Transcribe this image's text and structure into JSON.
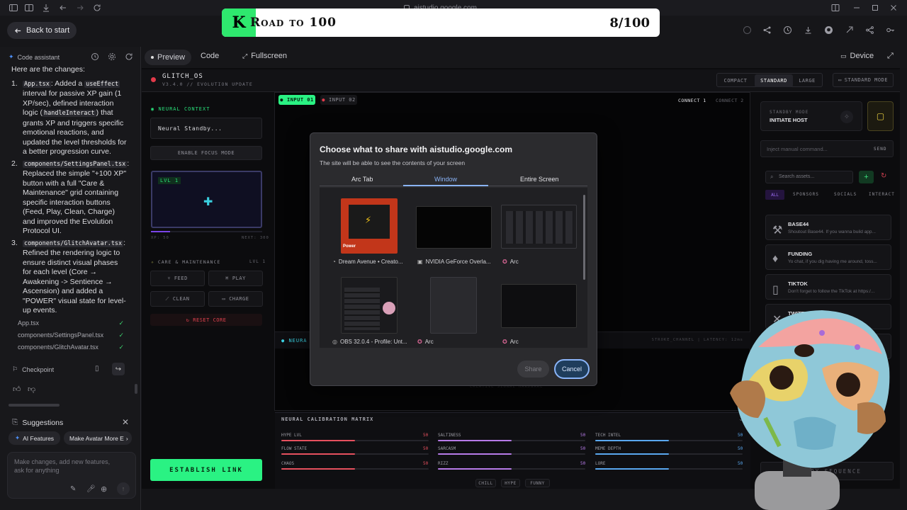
{
  "browser": {
    "url": "aistudio.google.com"
  },
  "overlay": {
    "logo_letter": "K",
    "title": "Road to 100",
    "counter": "8/100"
  },
  "header": {
    "back_label": "Back to start"
  },
  "left_panel": {
    "title": "Code assistant",
    "intro": "Here are the changes:",
    "changes": [
      {
        "num": "1.",
        "file": "App.tsx",
        "text_a": ": Added a ",
        "code": "useEffect",
        "text_b": " interval for passive XP gain (1 XP/sec), defined interaction logic (",
        "code2": "handleInteract",
        "text_c": ") that grants XP and triggers specific emotional reactions, and updated the level thresholds for a better progression curve."
      },
      {
        "num": "2.",
        "file": "components/SettingsPanel.tsx",
        "text_a": ": Replaced the simple \"+100 XP\" button with a full \"Care & Maintenance\" grid containing specific interaction buttons (Feed, Play, Clean, Charge) and improved the Evolution Protocol UI."
      },
      {
        "num": "3.",
        "file": "components/GlitchAvatar.tsx",
        "text_a": ": Refined the rendering logic to ensure distinct visual phases for each level (Core → Awakening -> Sentience → Ascension) and added a \"POWER\" visual state for level-up events."
      }
    ],
    "files": [
      "App.tsx",
      "components/SettingsPanel.tsx",
      "components/GlitchAvatar.tsx"
    ],
    "checkpoint": "Checkpoint",
    "suggestions_title": "Suggestions",
    "suggestion_chips": [
      "AI Features",
      "Make Avatar More E"
    ],
    "input_placeholder": "Make changes, add new features, ask for anything"
  },
  "tabs": {
    "preview": "Preview",
    "code": "Code",
    "fullscreen": "Fullscreen",
    "device": "Device"
  },
  "app": {
    "name": "GLITCH_OS",
    "version": "V3.4.0 // EVOLUTION UPDATE",
    "view_modes": [
      "COMPACT",
      "STANDARD",
      "LARGE"
    ],
    "mode_button": "STANDARD MODE",
    "neural_context": "NEURAL CONTEXT",
    "standby_text": "Neural Standby...",
    "focus_mode": "ENABLE FOCUS MODE",
    "level": "LVL 1",
    "xp": "XP: 50",
    "next": "NEXT: 300",
    "xp_progress": 0.17,
    "care_title": "CARE & MAINTENANCE",
    "care_level": "LVL 1",
    "care_buttons": [
      "FEED",
      "PLAY",
      "CLEAN",
      "CHARGE"
    ],
    "reset_core": "RESET CORE",
    "establish_link": "ESTABLISH LINK",
    "inputs": [
      "INPUT 01",
      "INPUT 02"
    ],
    "connects": [
      "CONNECT 1",
      "CONNECT 2"
    ],
    "neural_label": "NEURA",
    "status_right": "STROKE_CHANNEL  |  LATENCY: 12ms",
    "footer_watermark": "CREATIVE SIGNAL HARDWARE",
    "calibration_title": "NEURAL CALIBRATION MATRIX",
    "stats": [
      {
        "label": "HYPE LVL",
        "value": "50",
        "fill": 0.5,
        "color": "#e6505e"
      },
      {
        "label": "FLOW STATE",
        "value": "50",
        "fill": 0.5,
        "color": "#e6505e"
      },
      {
        "label": "CHAOS",
        "value": "50",
        "fill": 0.5,
        "color": "#e6505e"
      },
      {
        "label": "SALTINESS",
        "value": "50",
        "fill": 0.5,
        "color": "#b77be8"
      },
      {
        "label": "SARCASM",
        "value": "50",
        "fill": 0.5,
        "color": "#b77be8"
      },
      {
        "label": "RIZZ",
        "value": "50",
        "fill": 0.5,
        "color": "#b77be8"
      },
      {
        "label": "TECH INTEL",
        "value": "50",
        "fill": 0.5,
        "color": "#5aa8f0"
      },
      {
        "label": "MEME DEPTH",
        "value": "50",
        "fill": 0.5,
        "color": "#5aa8f0"
      },
      {
        "label": "LORE",
        "value": "50",
        "fill": 0.5,
        "color": "#5aa8f0"
      }
    ],
    "mood_chips": [
      "CHILL",
      "HYPE",
      "FUNNY"
    ],
    "standby_mode": "STANDBY MODE",
    "initiate_host": "INITIATE HOST",
    "command_placeholder": "Inject manual command...",
    "send": "SEND",
    "search_placeholder": "Search assets...",
    "asset_tabs": [
      "ALL",
      "SPONSORS",
      "SOCIALS",
      "INTERACT"
    ],
    "assets": [
      {
        "title": "BASE44",
        "desc": "Shoutout Base44. If you wanna build app..."
      },
      {
        "title": "FUNDING",
        "desc": "Yo chat, if you dig having me around, toss..."
      },
      {
        "title": "TIKTOK",
        "desc": "Don't forget to follow the TikTok at https:/..."
      },
      {
        "title": "TWITTER",
        "desc": "... He posts ban..."
      }
    ],
    "deploy": "DEPLOY SEQUENCE"
  },
  "dialog": {
    "title": "Choose what to share with aistudio.google.com",
    "subtitle": "The site will be able to see the contents of your screen",
    "tabs": [
      "Arc Tab",
      "Window",
      "Entire Screen"
    ],
    "active_tab": "Window",
    "windows": [
      "Dream Avenue • Creato...",
      "NVIDIA GeForce Overla...",
      "Arc",
      "OBS 32.0.4 - Profile: Unt...",
      "Arc",
      "Arc"
    ],
    "power_title": "Power",
    "share": "Share",
    "cancel": "Cancel"
  }
}
